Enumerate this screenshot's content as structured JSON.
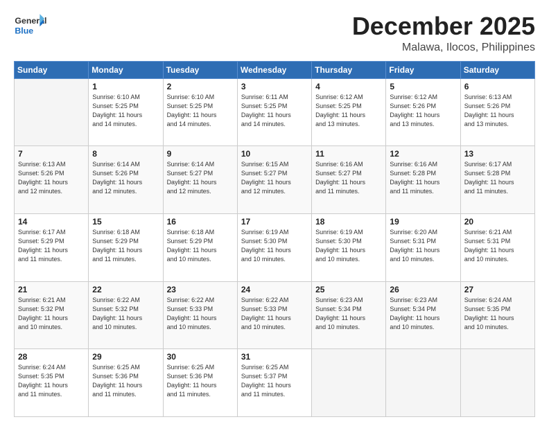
{
  "logo": {
    "line1": "General",
    "line2": "Blue"
  },
  "header": {
    "month": "December 2025",
    "location": "Malawa, Ilocos, Philippines"
  },
  "weekdays": [
    "Sunday",
    "Monday",
    "Tuesday",
    "Wednesday",
    "Thursday",
    "Friday",
    "Saturday"
  ],
  "weeks": [
    [
      {
        "day": "",
        "info": ""
      },
      {
        "day": "1",
        "info": "Sunrise: 6:10 AM\nSunset: 5:25 PM\nDaylight: 11 hours\nand 14 minutes."
      },
      {
        "day": "2",
        "info": "Sunrise: 6:10 AM\nSunset: 5:25 PM\nDaylight: 11 hours\nand 14 minutes."
      },
      {
        "day": "3",
        "info": "Sunrise: 6:11 AM\nSunset: 5:25 PM\nDaylight: 11 hours\nand 14 minutes."
      },
      {
        "day": "4",
        "info": "Sunrise: 6:12 AM\nSunset: 5:25 PM\nDaylight: 11 hours\nand 13 minutes."
      },
      {
        "day": "5",
        "info": "Sunrise: 6:12 AM\nSunset: 5:26 PM\nDaylight: 11 hours\nand 13 minutes."
      },
      {
        "day": "6",
        "info": "Sunrise: 6:13 AM\nSunset: 5:26 PM\nDaylight: 11 hours\nand 13 minutes."
      }
    ],
    [
      {
        "day": "7",
        "info": "Sunrise: 6:13 AM\nSunset: 5:26 PM\nDaylight: 11 hours\nand 12 minutes."
      },
      {
        "day": "8",
        "info": "Sunrise: 6:14 AM\nSunset: 5:26 PM\nDaylight: 11 hours\nand 12 minutes."
      },
      {
        "day": "9",
        "info": "Sunrise: 6:14 AM\nSunset: 5:27 PM\nDaylight: 11 hours\nand 12 minutes."
      },
      {
        "day": "10",
        "info": "Sunrise: 6:15 AM\nSunset: 5:27 PM\nDaylight: 11 hours\nand 12 minutes."
      },
      {
        "day": "11",
        "info": "Sunrise: 6:16 AM\nSunset: 5:27 PM\nDaylight: 11 hours\nand 11 minutes."
      },
      {
        "day": "12",
        "info": "Sunrise: 6:16 AM\nSunset: 5:28 PM\nDaylight: 11 hours\nand 11 minutes."
      },
      {
        "day": "13",
        "info": "Sunrise: 6:17 AM\nSunset: 5:28 PM\nDaylight: 11 hours\nand 11 minutes."
      }
    ],
    [
      {
        "day": "14",
        "info": "Sunrise: 6:17 AM\nSunset: 5:29 PM\nDaylight: 11 hours\nand 11 minutes."
      },
      {
        "day": "15",
        "info": "Sunrise: 6:18 AM\nSunset: 5:29 PM\nDaylight: 11 hours\nand 11 minutes."
      },
      {
        "day": "16",
        "info": "Sunrise: 6:18 AM\nSunset: 5:29 PM\nDaylight: 11 hours\nand 10 minutes."
      },
      {
        "day": "17",
        "info": "Sunrise: 6:19 AM\nSunset: 5:30 PM\nDaylight: 11 hours\nand 10 minutes."
      },
      {
        "day": "18",
        "info": "Sunrise: 6:19 AM\nSunset: 5:30 PM\nDaylight: 11 hours\nand 10 minutes."
      },
      {
        "day": "19",
        "info": "Sunrise: 6:20 AM\nSunset: 5:31 PM\nDaylight: 11 hours\nand 10 minutes."
      },
      {
        "day": "20",
        "info": "Sunrise: 6:21 AM\nSunset: 5:31 PM\nDaylight: 11 hours\nand 10 minutes."
      }
    ],
    [
      {
        "day": "21",
        "info": "Sunrise: 6:21 AM\nSunset: 5:32 PM\nDaylight: 11 hours\nand 10 minutes."
      },
      {
        "day": "22",
        "info": "Sunrise: 6:22 AM\nSunset: 5:32 PM\nDaylight: 11 hours\nand 10 minutes."
      },
      {
        "day": "23",
        "info": "Sunrise: 6:22 AM\nSunset: 5:33 PM\nDaylight: 11 hours\nand 10 minutes."
      },
      {
        "day": "24",
        "info": "Sunrise: 6:22 AM\nSunset: 5:33 PM\nDaylight: 11 hours\nand 10 minutes."
      },
      {
        "day": "25",
        "info": "Sunrise: 6:23 AM\nSunset: 5:34 PM\nDaylight: 11 hours\nand 10 minutes."
      },
      {
        "day": "26",
        "info": "Sunrise: 6:23 AM\nSunset: 5:34 PM\nDaylight: 11 hours\nand 10 minutes."
      },
      {
        "day": "27",
        "info": "Sunrise: 6:24 AM\nSunset: 5:35 PM\nDaylight: 11 hours\nand 10 minutes."
      }
    ],
    [
      {
        "day": "28",
        "info": "Sunrise: 6:24 AM\nSunset: 5:35 PM\nDaylight: 11 hours\nand 11 minutes."
      },
      {
        "day": "29",
        "info": "Sunrise: 6:25 AM\nSunset: 5:36 PM\nDaylight: 11 hours\nand 11 minutes."
      },
      {
        "day": "30",
        "info": "Sunrise: 6:25 AM\nSunset: 5:36 PM\nDaylight: 11 hours\nand 11 minutes."
      },
      {
        "day": "31",
        "info": "Sunrise: 6:25 AM\nSunset: 5:37 PM\nDaylight: 11 hours\nand 11 minutes."
      },
      {
        "day": "",
        "info": ""
      },
      {
        "day": "",
        "info": ""
      },
      {
        "day": "",
        "info": ""
      }
    ]
  ]
}
